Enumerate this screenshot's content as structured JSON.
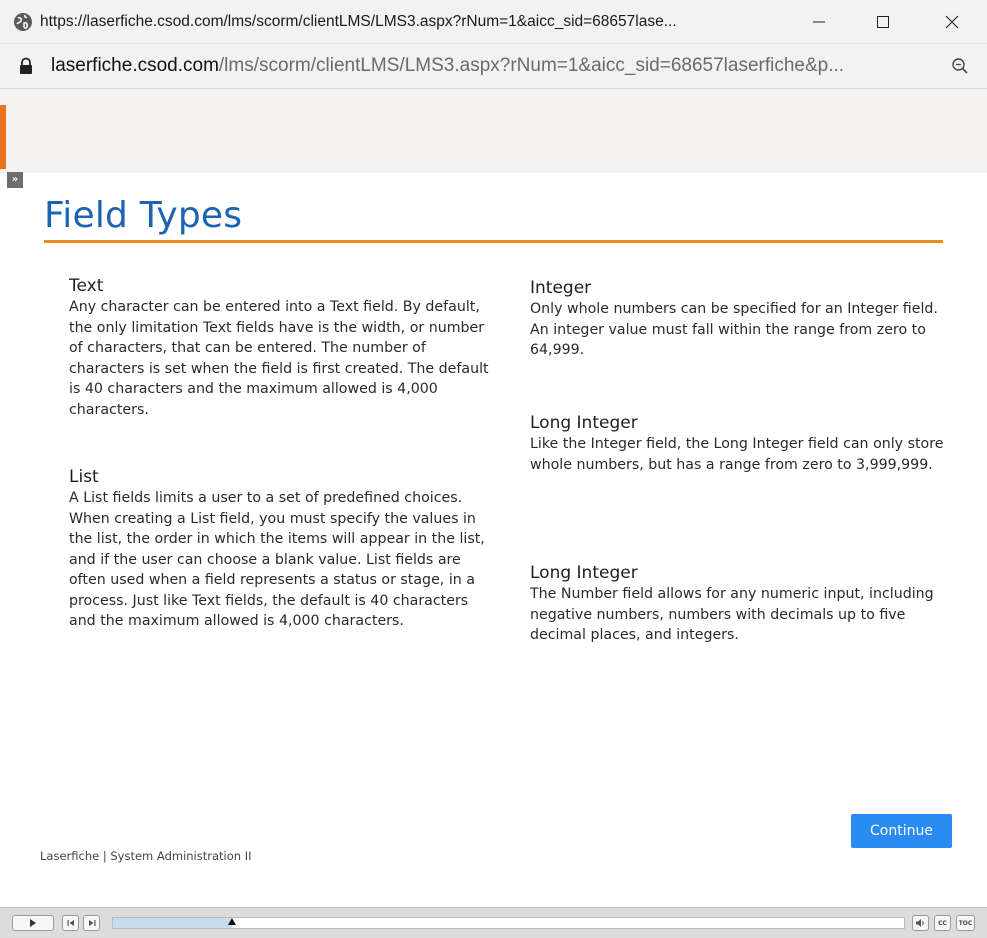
{
  "window": {
    "title": "https://laserfiche.csod.com/lms/scorm/clientLMS/LMS3.aspx?rNum=1&aicc_sid=68657lase..."
  },
  "address_bar": {
    "domain": "laserfiche.csod.com",
    "path": "/lms/scorm/clientLMS/LMS3.aspx?rNum=1&aicc_sid=68657laserfiche&p..."
  },
  "slide": {
    "title": "Field Types",
    "sections": {
      "text": {
        "heading": "Text",
        "body": "Any character can be entered into a Text field. By default, the only limitation Text fields have is the width, or number of characters, that can be entered. The number of characters is set when the field is first created. The default is 40 characters and the maximum allowed is 4,000 characters."
      },
      "list": {
        "heading": "List",
        "body": "A List fields limits a user to a set of predefined choices. When creating a List field, you must specify the values in the list, the order in which the items will appear in the list, and if the user can choose a blank value. List fields are often used when a field represents a status or stage, in a process. Just like Text fields, the default is 40 characters and the maximum allowed is 4,000 characters."
      },
      "integer": {
        "heading": "Integer",
        "body": "Only whole numbers can be specified for an Integer field. An integer value must fall within the range from zero to 64,999."
      },
      "long_integer": {
        "heading": "Long Integer",
        "body": "Like the Integer field, the Long Integer field can only store whole numbers, but has a range from zero to 3,999,999."
      },
      "number": {
        "heading": "Long Integer",
        "body": "The Number field allows for any numeric input, including negative numbers, numbers with decimals up to five decimal places, and integers."
      }
    },
    "footer": "Laserfiche | System Administration II",
    "continue_label": "Continue"
  },
  "player": {
    "progress": 0.15,
    "cc_label": "CC",
    "toc_label": "TOC"
  },
  "colors": {
    "title_blue": "#1c63b4",
    "accent_orange": "#f08a1c",
    "button_blue": "#2a8bf2"
  },
  "icons": {
    "globe": "globe-icon",
    "lock": "lock-icon",
    "zoom": "zoom-icon",
    "minimize": "minimize-icon",
    "maximize": "maximize-icon",
    "close": "close-icon",
    "expand": "expand-icon",
    "play": "play-icon",
    "prev": "previous-icon",
    "next": "next-icon",
    "volume": "volume-icon"
  }
}
